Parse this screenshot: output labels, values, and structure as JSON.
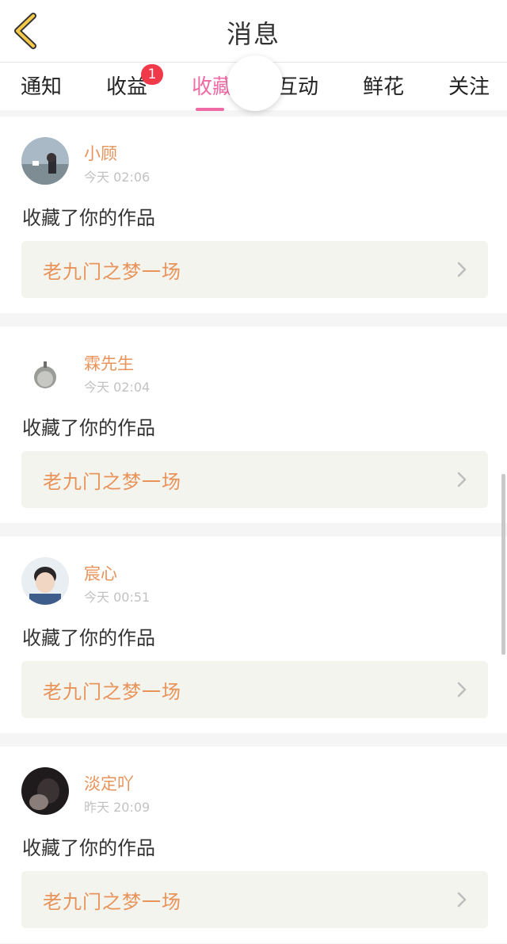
{
  "header": {
    "title": "消息",
    "back_icon": "back-chevron-icon"
  },
  "tabs": [
    {
      "label": "通知",
      "badge": ""
    },
    {
      "label": "收益",
      "badge": "1"
    },
    {
      "label": "收藏",
      "badge": "",
      "active": true
    },
    {
      "label": "互动",
      "badge": ""
    },
    {
      "label": "鲜花",
      "badge": ""
    },
    {
      "label": "关注",
      "badge": ""
    }
  ],
  "colors": {
    "accent": "#f06aa6",
    "badge": "#f03a4a",
    "name": "#e8935a",
    "work_bg": "#f4f4ee"
  },
  "feed": [
    {
      "user": "小顾",
      "time": "今天 02:06",
      "action": "收藏了你的作品",
      "work": "老九门之梦一场"
    },
    {
      "user": "霖先生",
      "time": "今天 02:04",
      "action": "收藏了你的作品",
      "work": "老九门之梦一场"
    },
    {
      "user": "宸心",
      "time": "今天 00:51",
      "action": "收藏了你的作品",
      "work": "老九门之梦一场"
    },
    {
      "user": "淡定吖",
      "time": "昨天 20:09",
      "action": "收藏了你的作品",
      "work": "老九门之梦一场"
    }
  ]
}
